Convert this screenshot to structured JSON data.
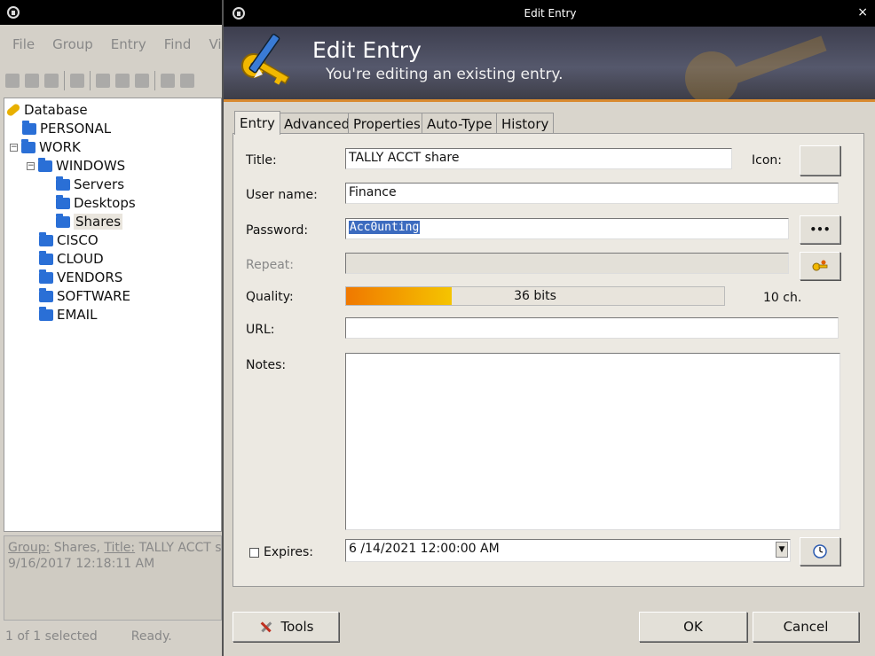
{
  "main": {
    "menu": [
      "File",
      "Group",
      "Entry",
      "Find",
      "Vi"
    ],
    "tree": {
      "root": "Database",
      "items": [
        "PERSONAL",
        "WORK",
        "WINDOWS",
        "Servers",
        "Desktops",
        "Shares",
        "CISCO",
        "CLOUD",
        "VENDORS",
        "SOFTWARE",
        "EMAIL"
      ]
    },
    "detail": {
      "group_label": "Group:",
      "group_value": "Shares,",
      "title_label": "Title:",
      "title_value": "TALLY ACCT sh",
      "timestamp": "9/16/2017 12:18:11 AM"
    },
    "status": {
      "selected": "1 of 1 selected",
      "state": "Ready."
    }
  },
  "dialog": {
    "window_title": "Edit Entry",
    "close_glyph": "×",
    "banner_title": "Edit Entry",
    "banner_subtitle": "You're editing an existing entry.",
    "tabs": [
      "Entry",
      "Advanced",
      "Properties",
      "Auto-Type",
      "History"
    ],
    "fields": {
      "title_label": "Title:",
      "title_value": "TALLY ACCT share",
      "icon_label": "Icon:",
      "username_label": "User name:",
      "username_value": "Finance",
      "password_label": "Password:",
      "password_value": "Acc0unting",
      "reveal_glyph": "•••",
      "repeat_label": "Repeat:",
      "quality_label": "Quality:",
      "quality_text": "36 bits",
      "quality_fraction": 0.28,
      "quality_chars": "10 ch.",
      "url_label": "URL:",
      "url_value": "",
      "notes_label": "Notes:",
      "notes_value": "",
      "expires_label": "Expires:",
      "expires_value": "6 /14/2021 12:00:00 AM"
    },
    "buttons": {
      "tools": "Tools",
      "ok": "OK",
      "cancel": "Cancel"
    }
  }
}
